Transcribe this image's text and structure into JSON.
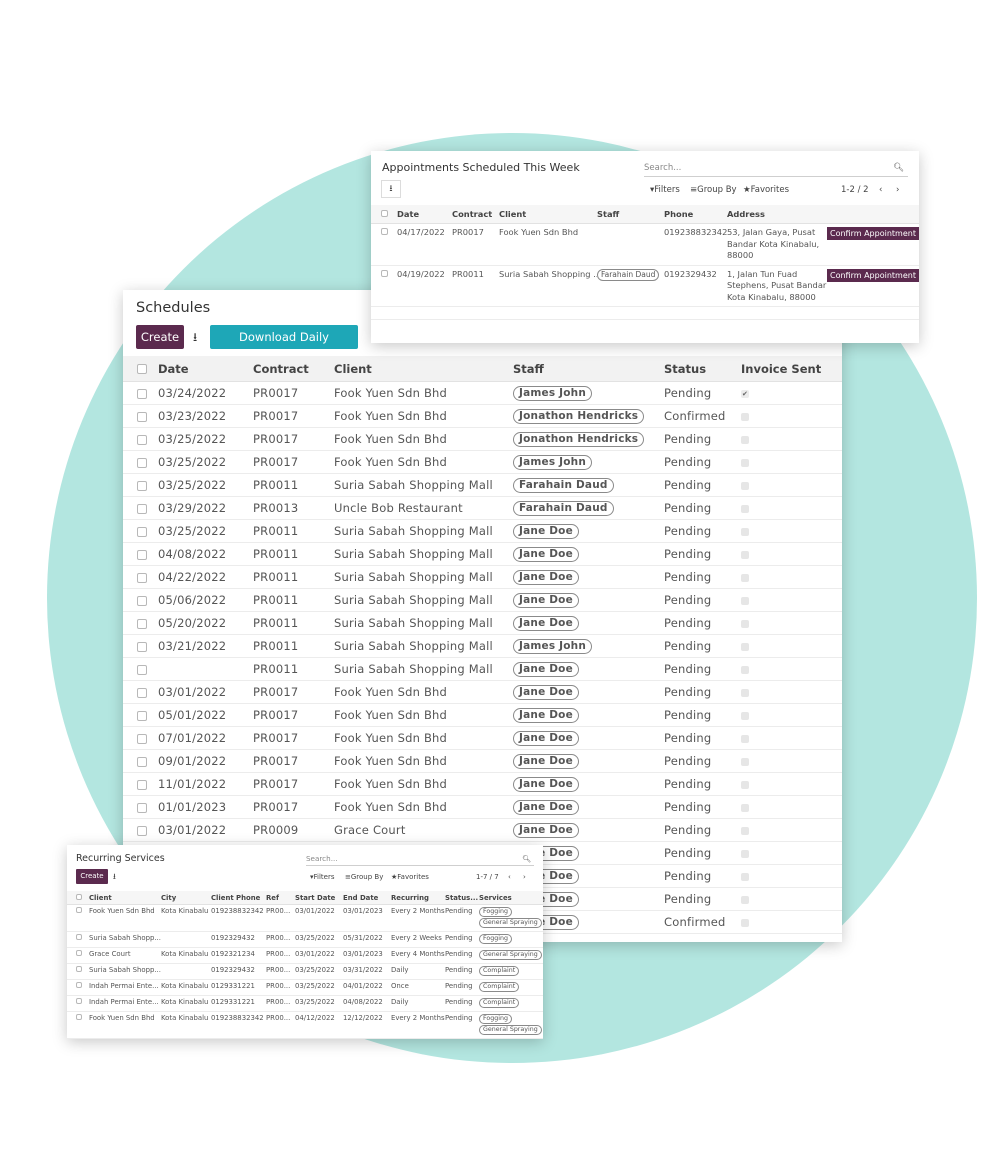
{
  "schedules": {
    "title": "Schedules",
    "create_label": "Create",
    "download_label": "Download Daily Worksheet",
    "columns": [
      "Date",
      "Contract",
      "Client",
      "Staff",
      "Status",
      "Invoice Sent"
    ],
    "rows": [
      {
        "date": "03/24/2022",
        "contract": "PR0017",
        "client": "Fook Yuen Sdn Bhd",
        "staff": "James John",
        "status": "Pending",
        "invoice": true
      },
      {
        "date": "03/23/2022",
        "contract": "PR0017",
        "client": "Fook Yuen Sdn Bhd",
        "staff": "Jonathon Hendricks",
        "status": "Confirmed",
        "invoice": false
      },
      {
        "date": "03/25/2022",
        "contract": "PR0017",
        "client": "Fook Yuen Sdn Bhd",
        "staff": "Jonathon Hendricks",
        "status": "Pending",
        "invoice": false
      },
      {
        "date": "03/25/2022",
        "contract": "PR0017",
        "client": "Fook Yuen Sdn Bhd",
        "staff": "James John",
        "status": "Pending",
        "invoice": false
      },
      {
        "date": "03/25/2022",
        "contract": "PR0011",
        "client": "Suria Sabah Shopping Mall",
        "staff": "Farahain Daud",
        "status": "Pending",
        "invoice": false
      },
      {
        "date": "03/29/2022",
        "contract": "PR0013",
        "client": "Uncle Bob Restaurant",
        "staff": "Farahain Daud",
        "status": "Pending",
        "invoice": false
      },
      {
        "date": "03/25/2022",
        "contract": "PR0011",
        "client": "Suria Sabah Shopping Mall",
        "staff": "Jane Doe",
        "status": "Pending",
        "invoice": false
      },
      {
        "date": "04/08/2022",
        "contract": "PR0011",
        "client": "Suria Sabah Shopping Mall",
        "staff": "Jane Doe",
        "status": "Pending",
        "invoice": false
      },
      {
        "date": "04/22/2022",
        "contract": "PR0011",
        "client": "Suria Sabah Shopping Mall",
        "staff": "Jane Doe",
        "status": "Pending",
        "invoice": false
      },
      {
        "date": "05/06/2022",
        "contract": "PR0011",
        "client": "Suria Sabah Shopping Mall",
        "staff": "Jane Doe",
        "status": "Pending",
        "invoice": false
      },
      {
        "date": "05/20/2022",
        "contract": "PR0011",
        "client": "Suria Sabah Shopping Mall",
        "staff": "Jane Doe",
        "status": "Pending",
        "invoice": false
      },
      {
        "date": "03/21/2022",
        "contract": "PR0011",
        "client": "Suria Sabah Shopping Mall",
        "staff": "James John",
        "status": "Pending",
        "invoice": false
      },
      {
        "date": "",
        "contract": "PR0011",
        "client": "Suria Sabah Shopping Mall",
        "staff": "Jane Doe",
        "status": "Pending",
        "invoice": false
      },
      {
        "date": "03/01/2022",
        "contract": "PR0017",
        "client": "Fook Yuen Sdn Bhd",
        "staff": "Jane Doe",
        "status": "Pending",
        "invoice": false
      },
      {
        "date": "05/01/2022",
        "contract": "PR0017",
        "client": "Fook Yuen Sdn Bhd",
        "staff": "Jane Doe",
        "status": "Pending",
        "invoice": false
      },
      {
        "date": "07/01/2022",
        "contract": "PR0017",
        "client": "Fook Yuen Sdn Bhd",
        "staff": "Jane Doe",
        "status": "Pending",
        "invoice": false
      },
      {
        "date": "09/01/2022",
        "contract": "PR0017",
        "client": "Fook Yuen Sdn Bhd",
        "staff": "Jane Doe",
        "status": "Pending",
        "invoice": false
      },
      {
        "date": "11/01/2022",
        "contract": "PR0017",
        "client": "Fook Yuen Sdn Bhd",
        "staff": "Jane Doe",
        "status": "Pending",
        "invoice": false
      },
      {
        "date": "01/01/2023",
        "contract": "PR0017",
        "client": "Fook Yuen Sdn Bhd",
        "staff": "Jane Doe",
        "status": "Pending",
        "invoice": false
      },
      {
        "date": "03/01/2022",
        "contract": "PR0009",
        "client": "Grace Court",
        "staff": "Jane Doe",
        "status": "Pending",
        "invoice": false
      },
      {
        "date": "",
        "contract": "",
        "client": "",
        "staff": "Jane Doe",
        "status": "Pending",
        "invoice": false
      },
      {
        "date": "",
        "contract": "",
        "client": "",
        "staff": "Jane Doe",
        "status": "Pending",
        "invoice": false
      },
      {
        "date": "",
        "contract": "",
        "client": "",
        "staff": "Jane Doe",
        "status": "Pending",
        "invoice": false
      },
      {
        "date": "",
        "contract": "",
        "client": "",
        "staff": "Jane Doe",
        "status": "Confirmed",
        "invoice": false
      }
    ]
  },
  "appointments": {
    "title": "Appointments Scheduled This Week",
    "search_placeholder": "Search...",
    "filters_label": "Filters",
    "groupby_label": "Group By",
    "favorites_label": "Favorites",
    "pager": "1-2 / 2",
    "columns": [
      "Date",
      "Contract",
      "Client",
      "Staff",
      "Phone",
      "Address"
    ],
    "confirm_label": "Confirm Appointment",
    "rows": [
      {
        "date": "04/17/2022",
        "contract": "PR0017",
        "client": "Fook Yuen Sdn Bhd",
        "staff": "",
        "phone": "019238832342",
        "address": "53, Jalan Gaya, Pusat Bandar Kota Kinabalu, 88000"
      },
      {
        "date": "04/19/2022",
        "contract": "PR0011",
        "client": "Suria Sabah Shopping ...",
        "staff": "Farahain Daud",
        "phone": "0192329432",
        "address": "1, Jalan Tun Fuad Stephens, Pusat Bandar Kota Kinabalu, 88000"
      }
    ]
  },
  "recurring": {
    "title": "Recurring Services",
    "create_label": "Create",
    "search_placeholder": "Search...",
    "filters_label": "Filters",
    "groupby_label": "Group By",
    "favorites_label": "Favorites",
    "pager": "1-7 / 7",
    "columns": [
      "Client",
      "City",
      "Client Phone",
      "Ref",
      "Start Date",
      "End Date",
      "Recurring",
      "Status...",
      "Services"
    ],
    "rows": [
      {
        "client": "Fook Yuen Sdn Bhd",
        "city": "Kota Kinabalu",
        "phone": "019238832342",
        "ref": "PR00...",
        "start": "03/01/2022",
        "end": "03/01/2023",
        "recurring": "Every 2 Months",
        "status": "Pending",
        "services": [
          "Fogging",
          "General Spraying"
        ]
      },
      {
        "client": "Suria Sabah Shopp...",
        "city": "",
        "phone": "0192329432",
        "ref": "PR00...",
        "start": "03/25/2022",
        "end": "05/31/2022",
        "recurring": "Every 2 Weeks",
        "status": "Pending",
        "services": [
          "Fogging"
        ]
      },
      {
        "client": "Grace Court",
        "city": "Kota Kinabalu",
        "phone": "0192321234",
        "ref": "PR00...",
        "start": "03/01/2022",
        "end": "03/01/2023",
        "recurring": "Every 4 Months",
        "status": "Pending",
        "services": [
          "General Spraying"
        ]
      },
      {
        "client": "Suria Sabah Shopp...",
        "city": "",
        "phone": "0192329432",
        "ref": "PR00...",
        "start": "03/25/2022",
        "end": "03/31/2022",
        "recurring": "Daily",
        "status": "Pending",
        "services": [
          "Complaint"
        ]
      },
      {
        "client": "Indah Permai Ente...",
        "city": "Kota Kinabalu",
        "phone": "0129331221",
        "ref": "PR00...",
        "start": "03/25/2022",
        "end": "04/01/2022",
        "recurring": "Once",
        "status": "Pending",
        "services": [
          "Complaint"
        ]
      },
      {
        "client": "Indah Permai Ente...",
        "city": "Kota Kinabalu",
        "phone": "0129331221",
        "ref": "PR00...",
        "start": "03/25/2022",
        "end": "04/08/2022",
        "recurring": "Daily",
        "status": "Pending",
        "services": [
          "Complaint"
        ]
      },
      {
        "client": "Fook Yuen Sdn Bhd",
        "city": "Kota Kinabalu",
        "phone": "019238832342",
        "ref": "PR00...",
        "start": "04/12/2022",
        "end": "12/12/2022",
        "recurring": "Every 2 Months",
        "status": "Pending",
        "services": [
          "Fogging",
          "General Spraying"
        ]
      }
    ]
  },
  "colors": {
    "primary": "#5b2a4e",
    "accent": "#1ea7b7",
    "background_circle": "#b3e6e0"
  }
}
